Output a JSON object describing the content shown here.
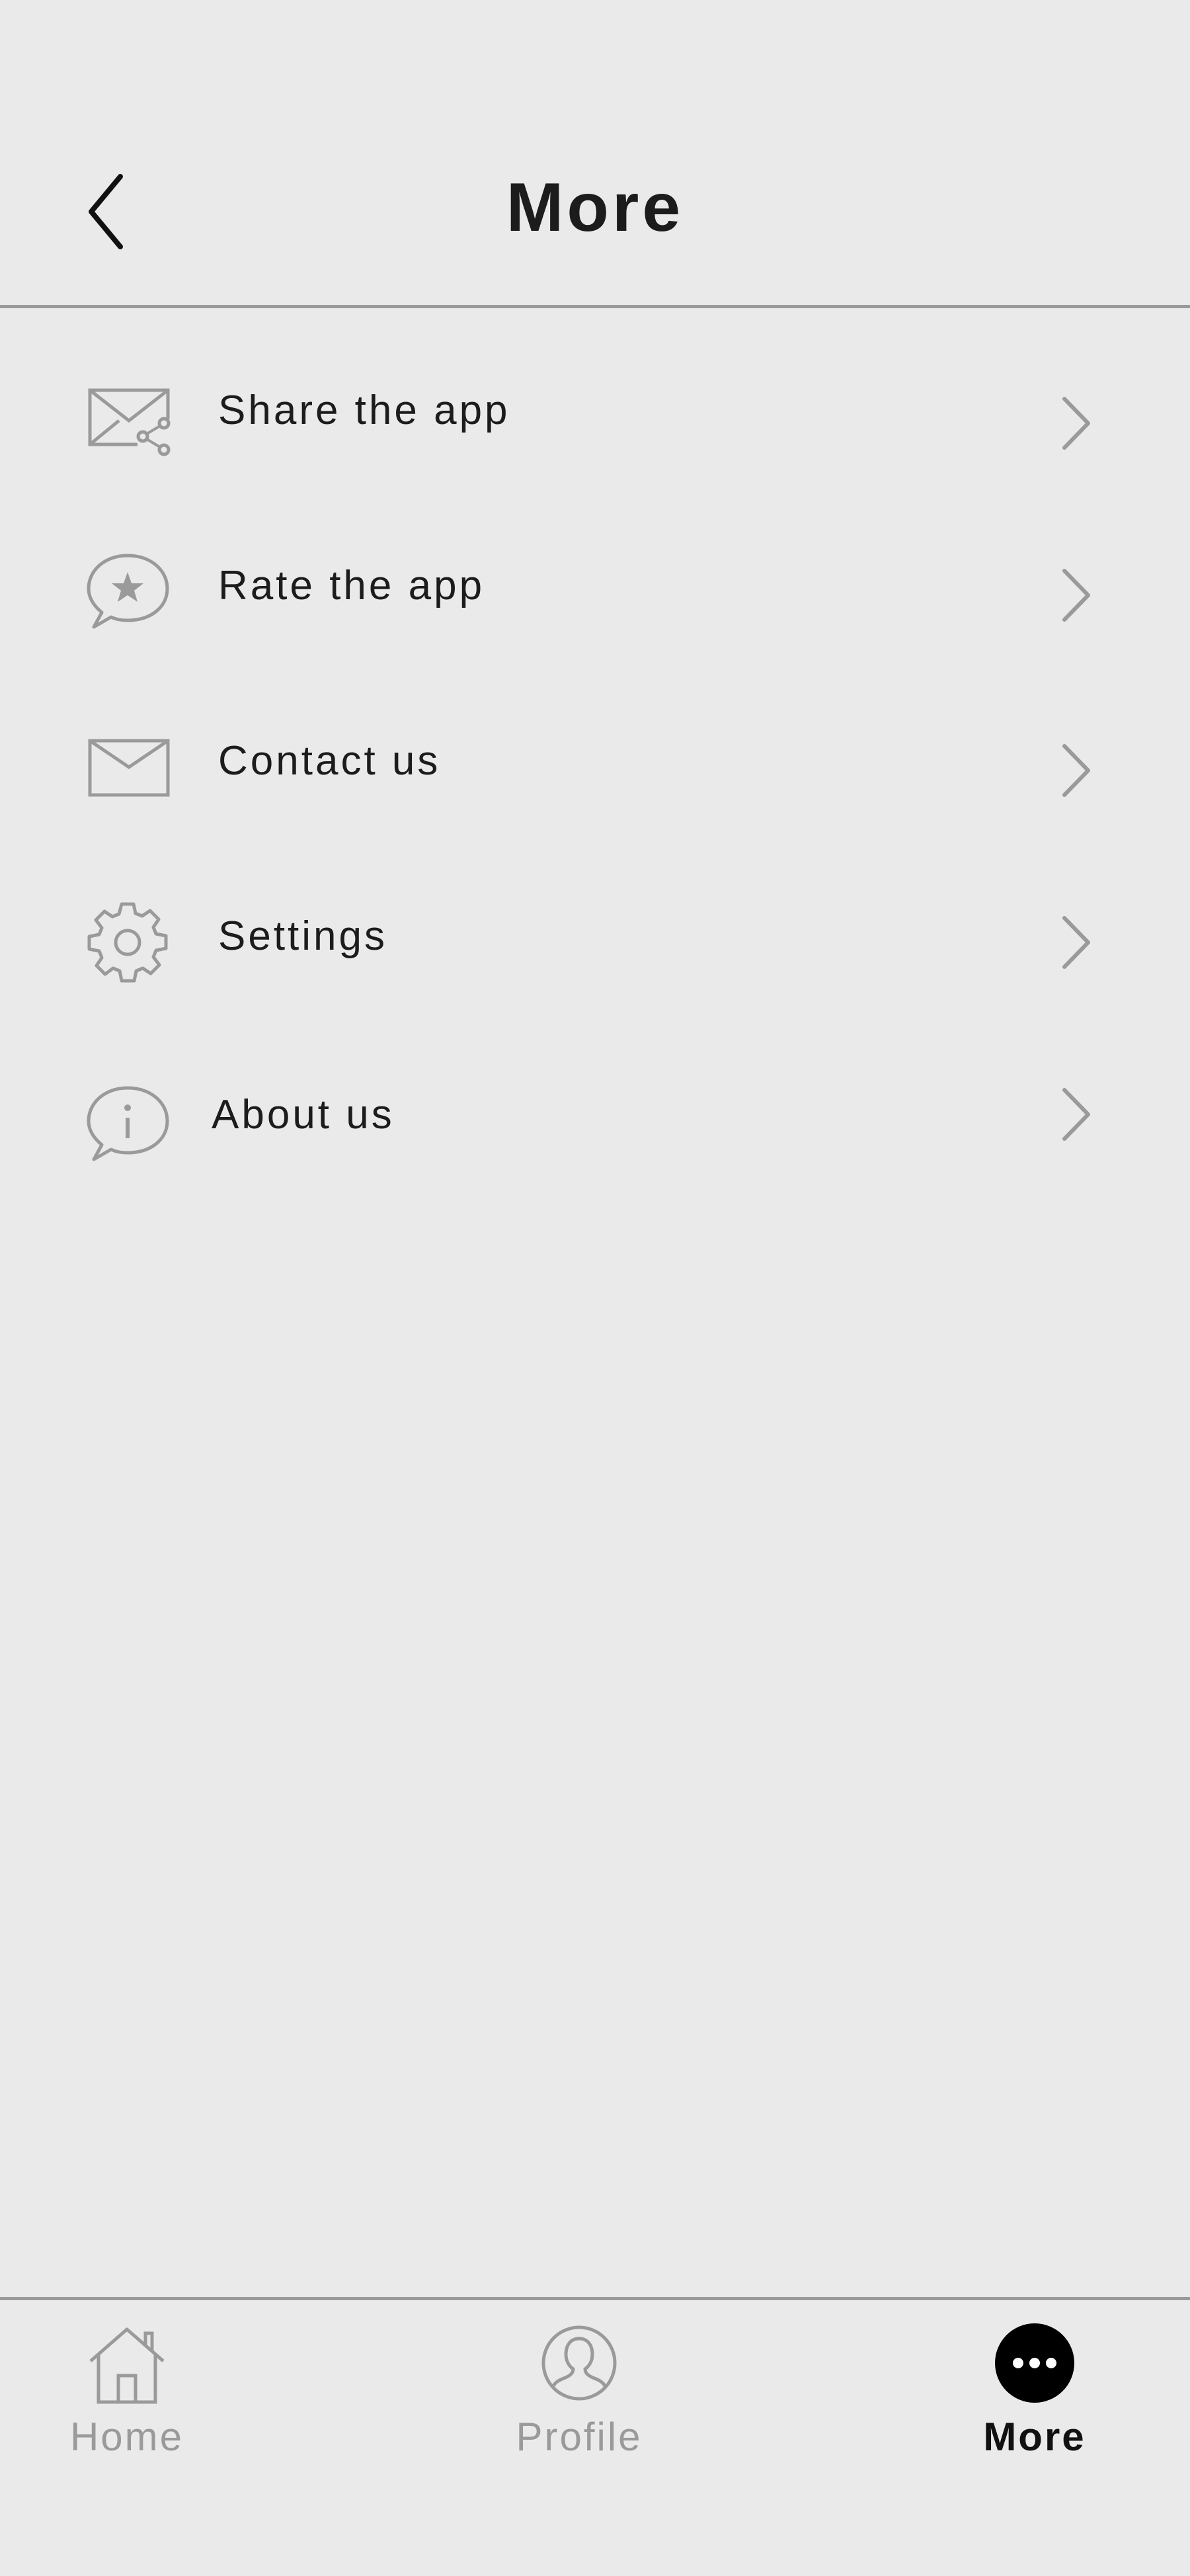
{
  "header": {
    "title": "More"
  },
  "menu": {
    "items": [
      {
        "label": "Share the app",
        "icon": "share-envelope-icon"
      },
      {
        "label": "Rate the app",
        "icon": "star-speech-bubble-icon"
      },
      {
        "label": "Contact us",
        "icon": "envelope-icon"
      },
      {
        "label": "Settings",
        "icon": "gear-icon"
      },
      {
        "label": "About us",
        "icon": "info-speech-bubble-icon"
      }
    ]
  },
  "tabbar": {
    "tabs": [
      {
        "label": "Home",
        "icon": "home-icon",
        "active": false
      },
      {
        "label": "Profile",
        "icon": "user-icon",
        "active": false
      },
      {
        "label": "More",
        "icon": "more-dots-icon",
        "active": true
      }
    ]
  },
  "colors": {
    "background": "#eaeaea",
    "text": "#1c1c1c",
    "icon_gray": "#9a9a9a",
    "active": "#111111"
  }
}
